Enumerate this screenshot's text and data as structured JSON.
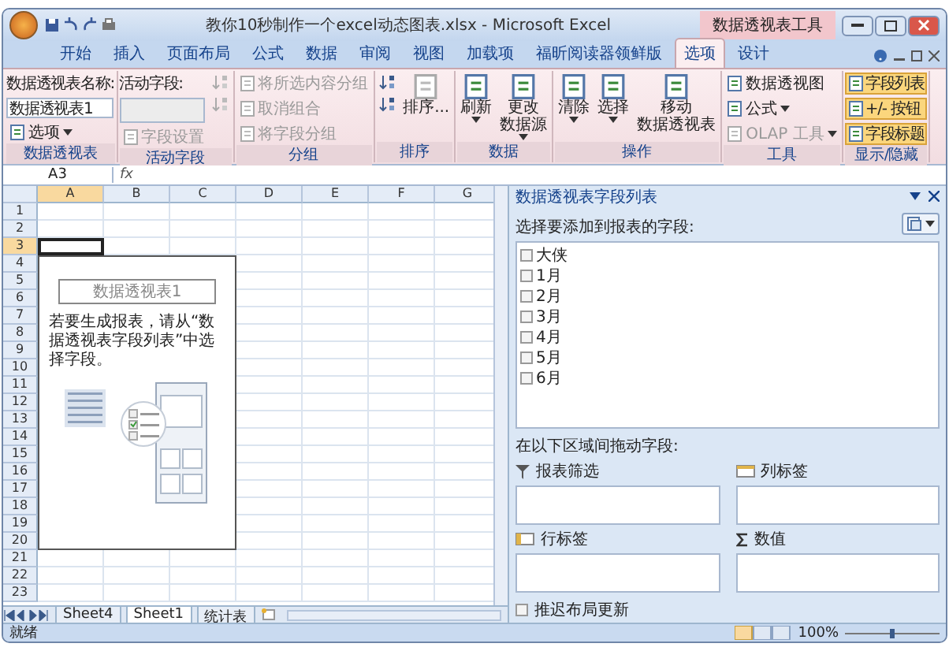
{
  "window": {
    "title": "教你10秒制作一个excel动态图表.xlsx - Microsoft Excel",
    "context_label": "数据透视表工具"
  },
  "tabs": [
    {
      "label": "开始",
      "selected": false
    },
    {
      "label": "插入",
      "selected": false
    },
    {
      "label": "页面布局",
      "selected": false
    },
    {
      "label": "公式",
      "selected": false
    },
    {
      "label": "数据",
      "selected": false
    },
    {
      "label": "审阅",
      "selected": false
    },
    {
      "label": "视图",
      "selected": false
    },
    {
      "label": "加载项",
      "selected": false
    },
    {
      "label": "福昕阅读器领鲜版",
      "selected": false
    },
    {
      "label": "选项",
      "selected": true
    },
    {
      "label": "设计",
      "selected": false
    }
  ],
  "ribbon": {
    "groups": [
      {
        "label": "数据透视表",
        "items": [
          {
            "kind": "label",
            "text": "数据透视表名称:"
          },
          {
            "kind": "input",
            "value": "数据透视表1",
            "disabled": false
          },
          {
            "kind": "small",
            "text": "选项",
            "dropdown": true,
            "disabled": false
          }
        ]
      },
      {
        "label": "活动字段",
        "items": [
          {
            "kind": "label",
            "text": "活动字段:"
          },
          {
            "kind": "input",
            "disabled": true
          },
          {
            "kind": "small",
            "text": "字段设置",
            "dropdown": false,
            "disabled": true
          },
          {
            "kind": "icon",
            "disabled": true
          },
          {
            "kind": "icon",
            "disabled": true
          }
        ]
      },
      {
        "label": "分组",
        "items": [
          {
            "kind": "small",
            "text": "将所选内容分组",
            "dropdown": false,
            "disabled": true
          },
          {
            "kind": "small",
            "text": "取消组合",
            "dropdown": false,
            "disabled": true
          },
          {
            "kind": "small",
            "text": "将字段分组",
            "dropdown": false,
            "disabled": true
          }
        ]
      },
      {
        "label": "排序",
        "items": [
          {
            "kind": "icon",
            "disabled": false
          },
          {
            "kind": "icon",
            "disabled": false
          },
          {
            "kind": "large",
            "lines": [
              "排序..."
            ],
            "dropdown": false,
            "disabled": true
          }
        ]
      },
      {
        "label": "数据",
        "items": [
          {
            "kind": "large",
            "lines": [
              "刷新"
            ],
            "dropdown": true,
            "disabled": false
          },
          {
            "kind": "large",
            "lines": [
              "更改",
              "数据源"
            ],
            "dropdown": true,
            "disabled": false
          }
        ]
      },
      {
        "label": "操作",
        "items": [
          {
            "kind": "large",
            "lines": [
              "清除"
            ],
            "dropdown": true,
            "disabled": false
          },
          {
            "kind": "large",
            "lines": [
              "选择"
            ],
            "dropdown": true,
            "disabled": false
          },
          {
            "kind": "large",
            "lines": [
              "移动",
              "数据透视表"
            ],
            "dropdown": false,
            "disabled": false
          }
        ]
      },
      {
        "label": "工具",
        "items": [
          {
            "kind": "small",
            "text": "数据透视图",
            "dropdown": false,
            "disabled": false
          },
          {
            "kind": "small",
            "text": "公式",
            "dropdown": true,
            "disabled": false
          },
          {
            "kind": "small",
            "text": "OLAP 工具",
            "dropdown": true,
            "disabled": true
          }
        ]
      },
      {
        "label": "显示/隐藏",
        "items": [
          {
            "kind": "toggle",
            "text": "字段列表",
            "on": true
          },
          {
            "kind": "toggle",
            "text": "+/- 按钮",
            "on": true
          },
          {
            "kind": "toggle",
            "text": "字段标题",
            "on": true
          }
        ]
      }
    ]
  },
  "formula_bar": {
    "name_box": "A3",
    "function_button": "fx"
  },
  "sheet": {
    "columns": [
      {
        "label": "A",
        "selected": true
      },
      {
        "label": "B",
        "selected": false
      },
      {
        "label": "C",
        "selected": false
      },
      {
        "label": "D",
        "selected": false
      },
      {
        "label": "E",
        "selected": false
      },
      {
        "label": "F",
        "selected": false
      },
      {
        "label": "G",
        "selected": false
      }
    ],
    "rows": [
      {
        "label": "1",
        "selected": false
      },
      {
        "label": "2",
        "selected": false
      },
      {
        "label": "3",
        "selected": true
      },
      {
        "label": "4",
        "selected": false
      },
      {
        "label": "5",
        "selected": false
      },
      {
        "label": "6",
        "selected": false
      },
      {
        "label": "7",
        "selected": false
      },
      {
        "label": "8",
        "selected": false
      },
      {
        "label": "9",
        "selected": false
      },
      {
        "label": "10",
        "selected": false
      },
      {
        "label": "11",
        "selected": false
      },
      {
        "label": "12",
        "selected": false
      },
      {
        "label": "13",
        "selected": false
      },
      {
        "label": "14",
        "selected": false
      },
      {
        "label": "15",
        "selected": false
      },
      {
        "label": "16",
        "selected": false
      },
      {
        "label": "17",
        "selected": false
      },
      {
        "label": "18",
        "selected": false
      },
      {
        "label": "19",
        "selected": false
      },
      {
        "label": "20",
        "selected": false
      },
      {
        "label": "21",
        "selected": false
      },
      {
        "label": "22",
        "selected": false
      },
      {
        "label": "23",
        "selected": false
      }
    ],
    "pivot_placeholder": {
      "title": "数据透视表1",
      "message": "若要生成报表，请从“数据透视表字段列表”中选择字段。"
    },
    "tabs": [
      {
        "label": "Sheet4",
        "selected": false
      },
      {
        "label": "Sheet1",
        "selected": true
      },
      {
        "label": "统计表",
        "selected": false
      }
    ]
  },
  "field_list": {
    "title": "数据透视表字段列表",
    "prompt": "选择要添加到报表的字段:",
    "fields": [
      {
        "label": "大侠",
        "checked": false
      },
      {
        "label": "1月",
        "checked": false
      },
      {
        "label": "2月",
        "checked": false
      },
      {
        "label": "3月",
        "checked": false
      },
      {
        "label": "4月",
        "checked": false
      },
      {
        "label": "5月",
        "checked": false
      },
      {
        "label": "6月",
        "checked": false
      }
    ],
    "areas_prompt": "在以下区域间拖动字段:",
    "areas": [
      {
        "kind": "filter",
        "label": "报表筛选"
      },
      {
        "kind": "columns",
        "label": "列标签"
      },
      {
        "kind": "rows",
        "label": "行标签"
      },
      {
        "kind": "values",
        "label": "数值"
      }
    ],
    "defer_update": {
      "label": "推迟布局更新",
      "checked": false
    }
  },
  "status_bar": {
    "status": "就绪",
    "zoom": "100%",
    "zoom_slider": {
      "level": 0.5
    }
  }
}
